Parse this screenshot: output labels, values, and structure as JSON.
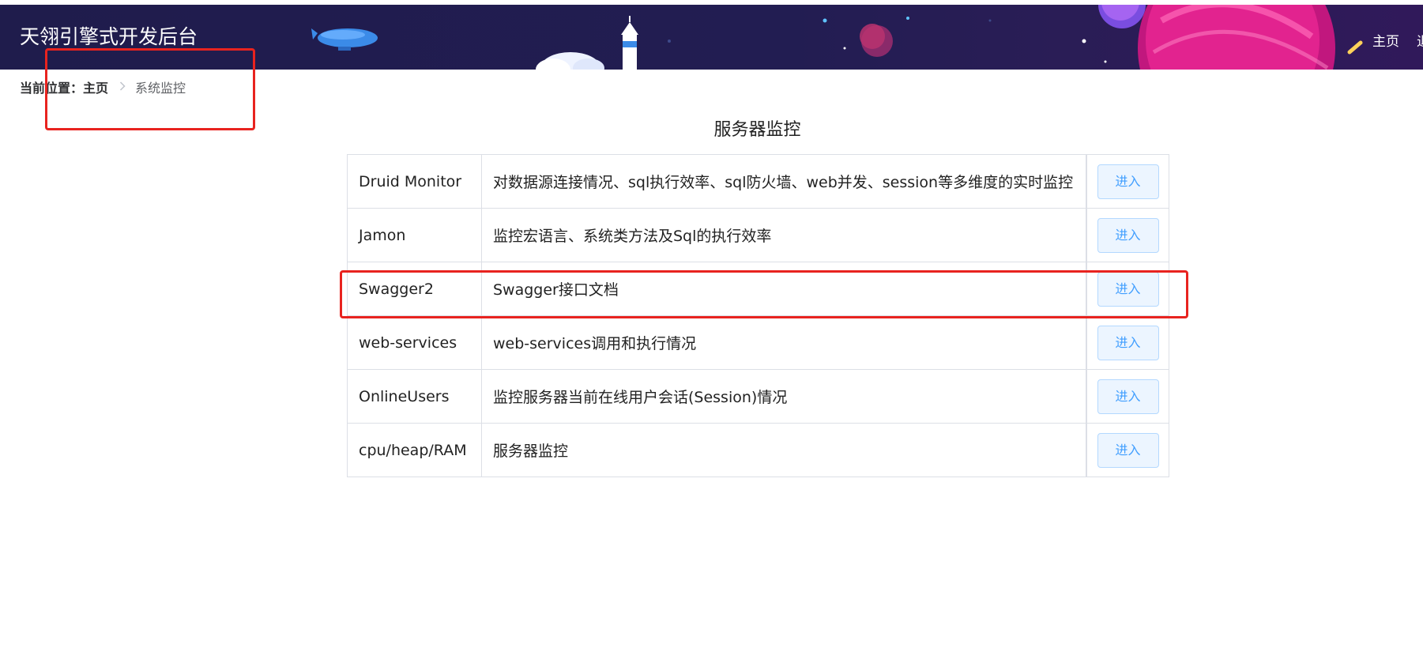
{
  "header": {
    "title": "天翎引擎式开发后台",
    "nav_home": "主页",
    "nav_more": "退出"
  },
  "breadcrumb": {
    "prefix": "当前位置：",
    "home": "主页",
    "separator": ">",
    "current": "系统监控"
  },
  "section_title": "服务器监控",
  "enter_label": "进入",
  "rows": [
    {
      "name": "Druid Monitor",
      "desc": "对数据源连接情况、sql执行效率、sql防火墙、web并发、session等多维度的实时监控"
    },
    {
      "name": "Jamon",
      "desc": "监控宏语言、系统类方法及Sql的执行效率"
    },
    {
      "name": "Swagger2",
      "desc": "Swagger接口文档"
    },
    {
      "name": "web-services",
      "desc": "web-services调用和执行情况"
    },
    {
      "name": "OnlineUsers",
      "desc": "监控服务器当前在线用户会话(Session)情况"
    },
    {
      "name": "cpu/heap/RAM",
      "desc": "服务器监控"
    }
  ],
  "colors": {
    "header_bg": "#201c4e",
    "button_bg": "#ecf5ff",
    "button_text": "#409eff",
    "annotation": "#e8231f"
  }
}
